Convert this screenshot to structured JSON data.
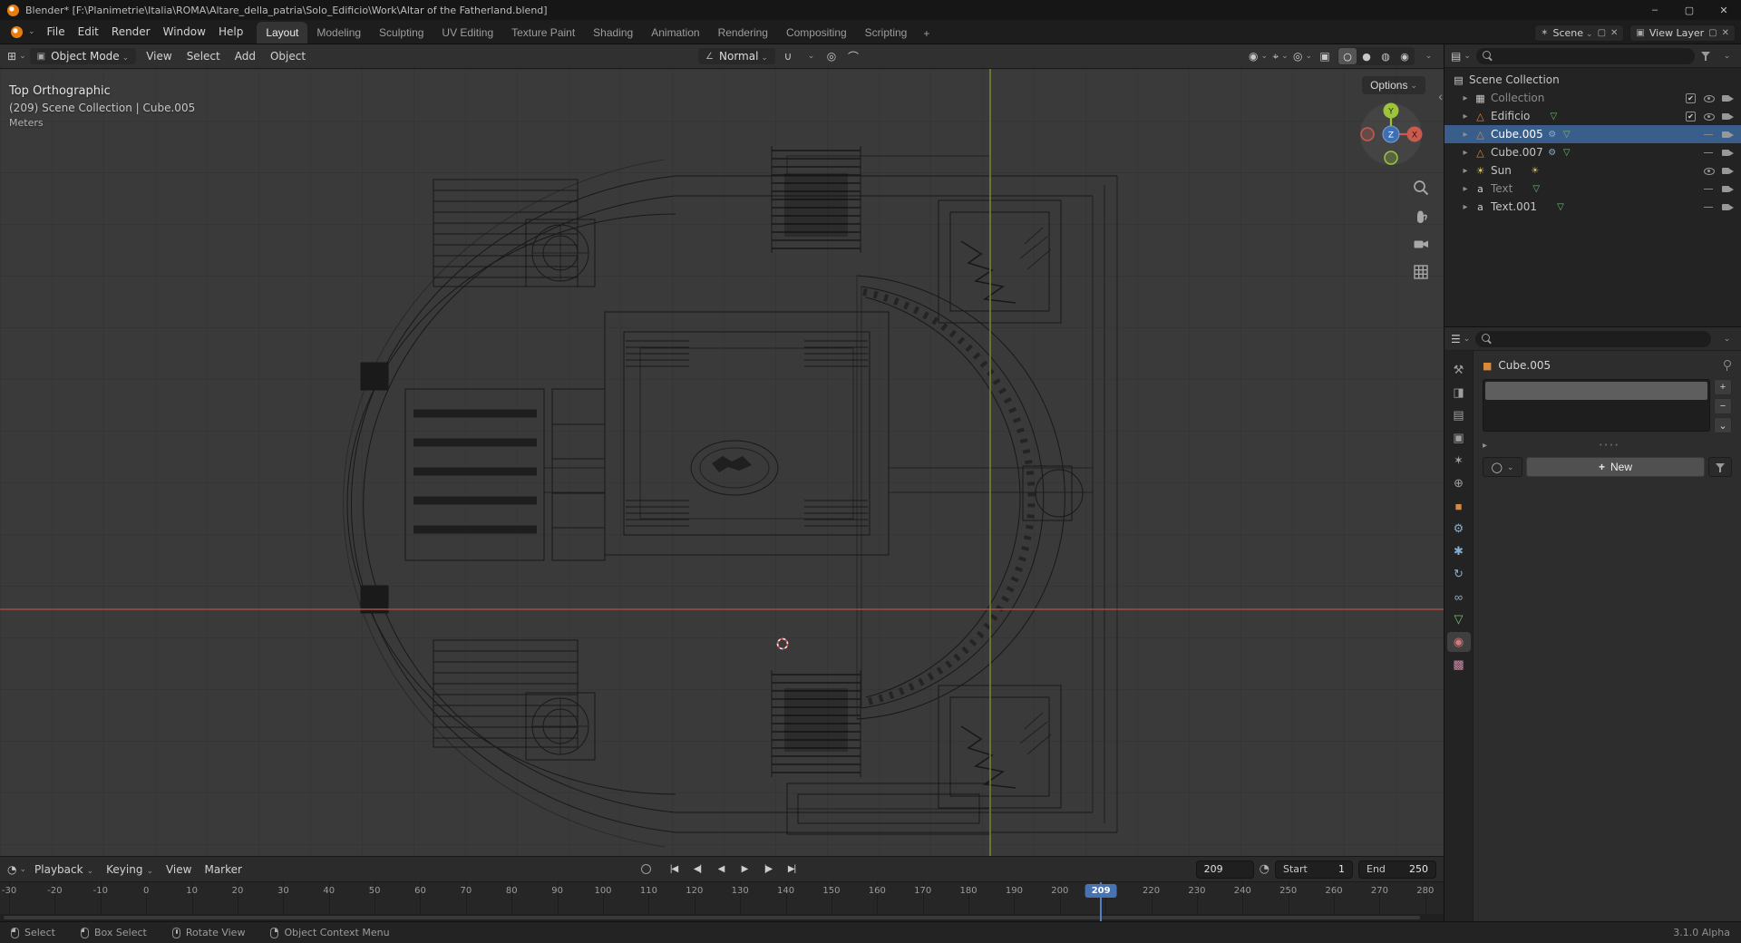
{
  "titlebar": {
    "title": "Blender* [F:\\Planimetrie\\Italia\\ROMA\\Altare_della_patria\\Solo_Edificio\\Work\\Altar of the Fatherland.blend]"
  },
  "topbar": {
    "menus": [
      "File",
      "Edit",
      "Render",
      "Window",
      "Help"
    ],
    "workspaces": [
      {
        "label": "Layout",
        "active": true
      },
      {
        "label": "Modeling",
        "active": false
      },
      {
        "label": "Sculpting",
        "active": false
      },
      {
        "label": "UV Editing",
        "active": false
      },
      {
        "label": "Texture Paint",
        "active": false
      },
      {
        "label": "Shading",
        "active": false
      },
      {
        "label": "Animation",
        "active": false
      },
      {
        "label": "Rendering",
        "active": false
      },
      {
        "label": "Compositing",
        "active": false
      },
      {
        "label": "Scripting",
        "active": false
      }
    ],
    "add_workspace": "+",
    "scene_label": "Scene",
    "view_layer_label": "View Layer"
  },
  "viewport": {
    "header": {
      "mode": "Object Mode",
      "menus": [
        "View",
        "Select",
        "Add",
        "Object"
      ],
      "orientation": "Normal"
    },
    "options_button": "Options",
    "overlay": {
      "view": "Top Orthographic",
      "context": "(209) Scene Collection | Cube.005",
      "units": "Meters"
    },
    "gizmo": {
      "x": "X",
      "y": "Y",
      "z": "Z"
    }
  },
  "outliner": {
    "root": "Scene Collection",
    "items": [
      {
        "label": "Collection",
        "icon": "collection",
        "dim": true,
        "checkbox": true,
        "eye": "open",
        "badges": ""
      },
      {
        "label": "Edificio",
        "icon": "mesh",
        "dim": false,
        "checkbox": true,
        "eye": "open",
        "badges": "data"
      },
      {
        "label": "Cube.005",
        "icon": "mesh",
        "dim": false,
        "checkbox": false,
        "eye": "closed",
        "badges": "mod data",
        "selected": true
      },
      {
        "label": "Cube.007",
        "icon": "mesh",
        "dim": false,
        "checkbox": false,
        "eye": "closed",
        "badges": "mod data"
      },
      {
        "label": "Sun",
        "icon": "sun",
        "dim": false,
        "checkbox": false,
        "eye": "open",
        "badges": "sun"
      },
      {
        "label": "Text",
        "icon": "text",
        "dim": true,
        "checkbox": false,
        "eye": "closed",
        "badges": "data"
      },
      {
        "label": "Text.001",
        "icon": "text",
        "dim": false,
        "checkbox": false,
        "eye": "closed",
        "badges": "data"
      }
    ]
  },
  "properties": {
    "active_object": "Cube.005",
    "new_material_button": "New",
    "tabs": [
      {
        "id": "tool",
        "glyph": "⚒",
        "active": false
      },
      {
        "id": "render",
        "glyph": "◨",
        "active": false
      },
      {
        "id": "output",
        "glyph": "▤",
        "active": false
      },
      {
        "id": "viewlayer",
        "glyph": "▣",
        "active": false
      },
      {
        "id": "scene",
        "glyph": "✶",
        "active": false
      },
      {
        "id": "world",
        "glyph": "⊕",
        "active": false
      },
      {
        "id": "object",
        "glyph": "■",
        "active": false
      },
      {
        "id": "modifiers",
        "glyph": "⚙",
        "active": false
      },
      {
        "id": "particles",
        "glyph": "✱",
        "active": false
      },
      {
        "id": "physics",
        "glyph": "↻",
        "active": false
      },
      {
        "id": "constraints",
        "glyph": "∞",
        "active": false
      },
      {
        "id": "data",
        "glyph": "▽",
        "active": false
      },
      {
        "id": "material",
        "glyph": "◉",
        "active": true
      },
      {
        "id": "texture",
        "glyph": "▩",
        "active": false
      }
    ]
  },
  "timeline": {
    "menus": [
      "Playback",
      "Keying",
      "View",
      "Marker"
    ],
    "transport": [
      {
        "name": "jump-to-start-button",
        "glyph": "|◀"
      },
      {
        "name": "previous-keyframe-button",
        "glyph": "◀|"
      },
      {
        "name": "play-reverse-button",
        "glyph": "◀"
      },
      {
        "name": "play-button",
        "glyph": "▶"
      },
      {
        "name": "next-keyframe-button",
        "glyph": "|▶"
      },
      {
        "name": "jump-to-end-button",
        "glyph": "▶|"
      }
    ],
    "current_frame": 209,
    "frame_field": "209",
    "start_label": "Start",
    "start_value": "1",
    "end_label": "End",
    "end_value": "250",
    "ruler": {
      "view_min": -32,
      "view_max": 284,
      "label_min": -30,
      "label_max": 280,
      "step": 10
    }
  },
  "statusbar": {
    "hints": [
      {
        "label": "Select",
        "button": "left"
      },
      {
        "label": "Box Select",
        "button": "drag"
      },
      {
        "label": "Rotate View",
        "button": "middle"
      },
      {
        "label": "Object Context Menu",
        "button": "right"
      }
    ],
    "version": "3.1.0 Alpha"
  },
  "colors": {
    "selection_blue": "#4772b3",
    "axis_x_red": "#a04a44",
    "axis_y_green": "#73862f",
    "viewport_bg": "#3a3a3a",
    "mesh_icon_orange": "#de8a3e"
  }
}
